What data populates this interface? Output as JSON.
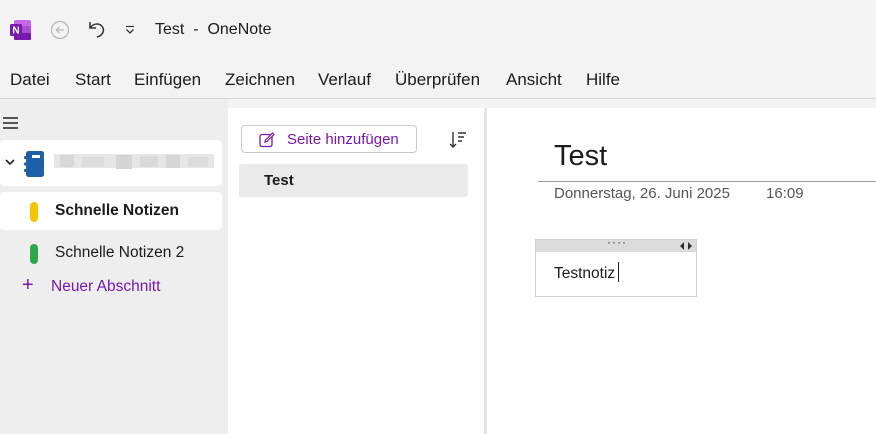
{
  "title_bar": {
    "title": "Test  -  OneNote",
    "icons": [
      "onenote-logo-icon",
      "back-arrow-icon",
      "undo-icon",
      "chevron-down-icon"
    ]
  },
  "menu": [
    "Datei",
    "Start",
    "Einfügen",
    "Zeichnen",
    "Verlauf",
    "Überprüfen",
    "Ansicht",
    "Hilfe"
  ],
  "sidebar": {
    "notebook": {
      "icon": "notebook-icon",
      "name_blurred": true
    },
    "sections": [
      {
        "label": "Schnelle Notizen",
        "color": "#f5c400",
        "active": true
      },
      {
        "label": "Schnelle Notizen 2",
        "color": "#2ea84a",
        "active": false
      }
    ],
    "add_section_label": "Neuer Abschnitt"
  },
  "page_list": {
    "add_page_label": "Seite hinzufügen",
    "pages": [
      "Test"
    ]
  },
  "page": {
    "title": "Test",
    "date": "Donnerstag, 26. Juni 2025",
    "time": "16:09",
    "note_text": "Testnotiz"
  },
  "colors": {
    "accent": "#7719aa",
    "logo": "#7719aa",
    "notebook": "#1f5fa8"
  }
}
